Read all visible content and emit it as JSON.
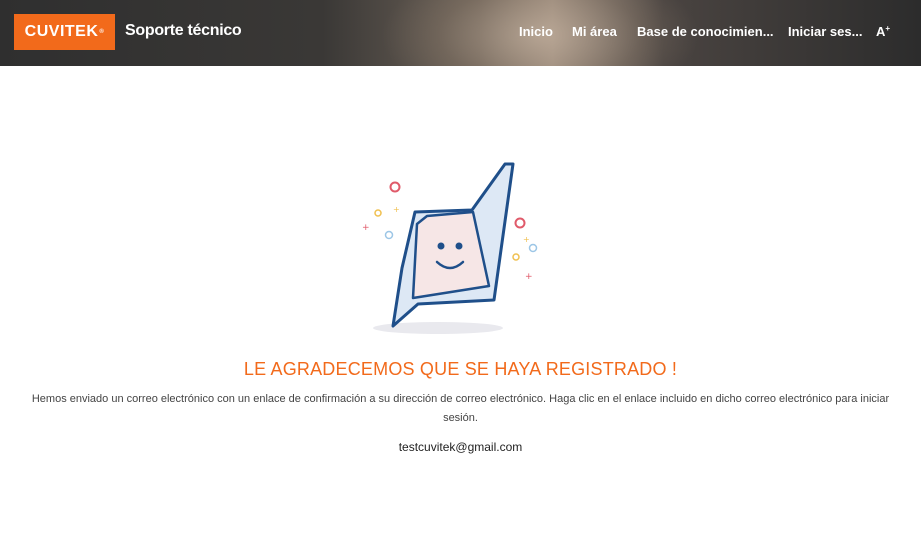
{
  "header": {
    "logo_text": "CUVITEK",
    "logo_mark": "®",
    "site_title": "Soporte técnico",
    "nav": [
      {
        "label": "Inicio"
      },
      {
        "label": "Mi área"
      },
      {
        "label": "Base de conocimien..."
      },
      {
        "label": "Iniciar ses..."
      }
    ],
    "text_size_glyph": "A",
    "text_size_mark": "+"
  },
  "main": {
    "heading": "LE AGRADECEMOS QUE SE HAYA REGISTRADO !",
    "message": "Hemos enviado un correo electrónico con un enlace de confirmación a su dirección de correo electrónico. Haga clic en el enlace incluido en dicho correo electrónico para iniciar sesión.",
    "email": "testcuvitek@gmail.com"
  },
  "colors": {
    "accent": "#f26a1b",
    "illustration_stroke": "#1f4f8a",
    "illustration_fill": "#f6e6e6"
  }
}
